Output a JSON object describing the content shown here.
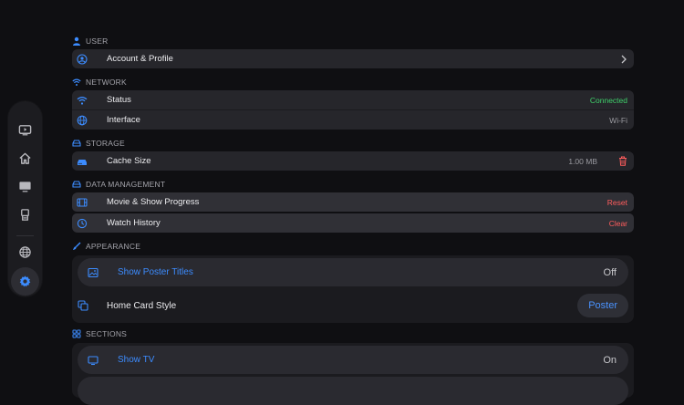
{
  "sidebar": {
    "items": [
      {
        "icon": "media-play-icon",
        "active": false
      },
      {
        "icon": "home-icon",
        "active": false
      },
      {
        "icon": "tv-icon",
        "active": false
      },
      {
        "icon": "library-icon",
        "active": false
      },
      {
        "icon": "globe-icon",
        "active": false
      },
      {
        "icon": "gear-icon",
        "active": true
      }
    ]
  },
  "sections": {
    "user": {
      "title": "USER",
      "rows": [
        {
          "label": "Account & Profile"
        }
      ]
    },
    "network": {
      "title": "NETWORK",
      "rows": [
        {
          "label": "Status",
          "value": "Connected"
        },
        {
          "label": "Interface",
          "value": "Wi-Fi"
        }
      ]
    },
    "storage": {
      "title": "STORAGE",
      "rows": [
        {
          "label": "Cache Size",
          "value": "1.00 MB"
        }
      ]
    },
    "data_management": {
      "title": "DATA MANAGEMENT",
      "rows": [
        {
          "label": "Movie & Show Progress",
          "action": "Reset"
        },
        {
          "label": "Watch History",
          "action": "Clear"
        }
      ]
    },
    "appearance": {
      "title": "APPEARANCE",
      "rows": [
        {
          "label": "Show Poster Titles",
          "value": "Off"
        },
        {
          "label": "Home Card Style",
          "value": "Poster"
        }
      ]
    },
    "sections": {
      "title": "SECTIONS",
      "rows": [
        {
          "label": "Show TV",
          "value": "On"
        }
      ]
    }
  },
  "colors": {
    "accent": "#3c8cff",
    "success": "#3fcf6a",
    "danger": "#ff5d5d",
    "background": "#0f0f12"
  }
}
